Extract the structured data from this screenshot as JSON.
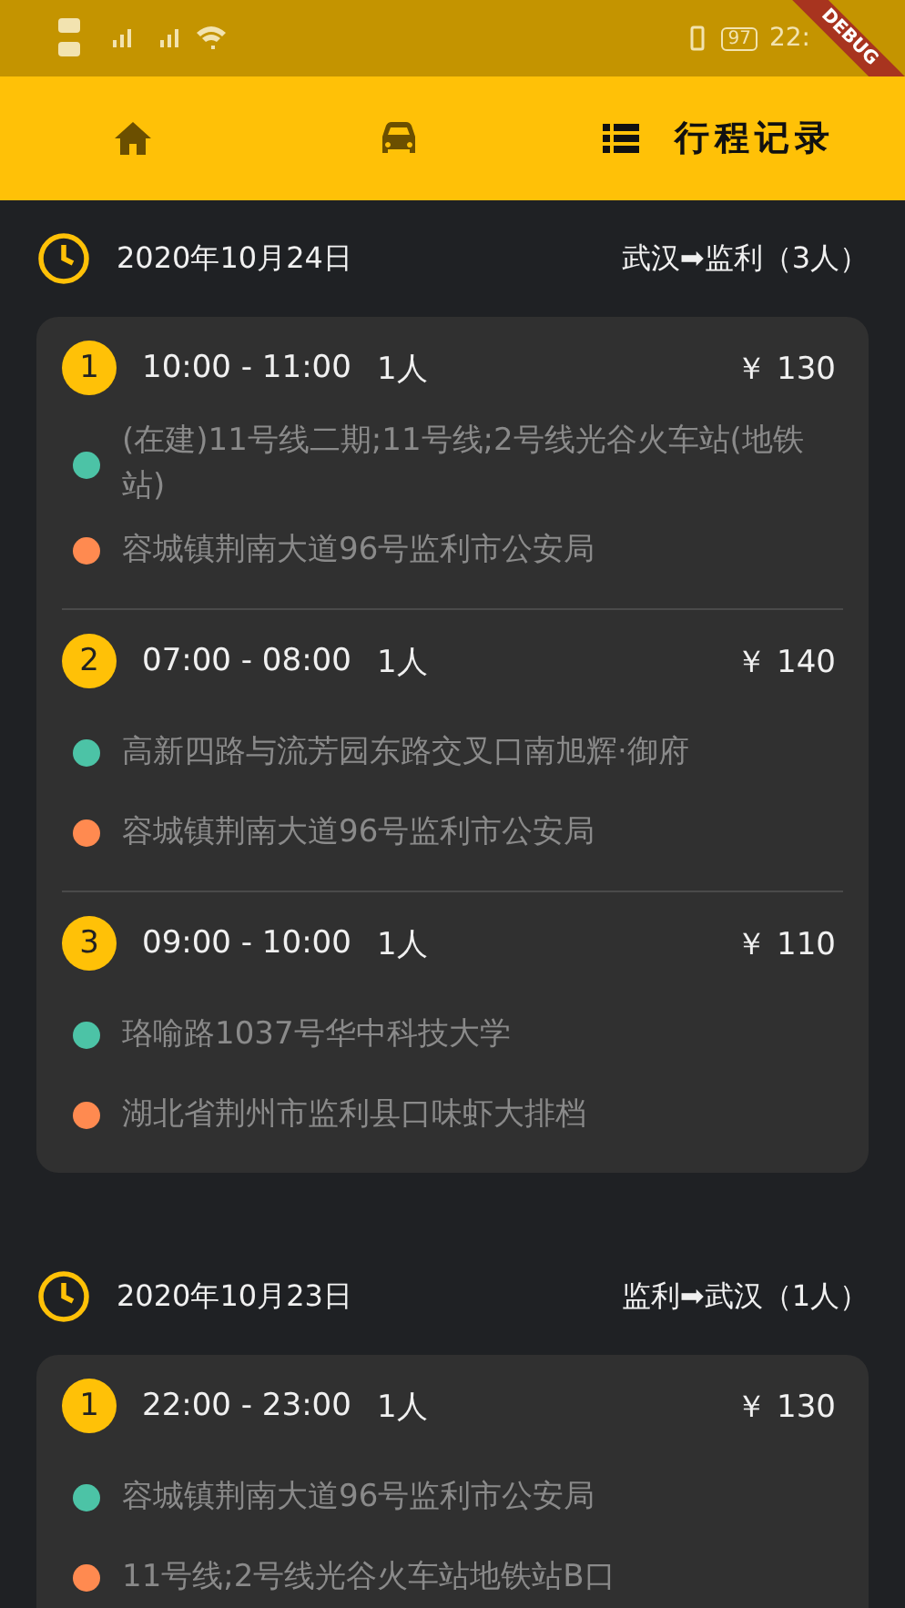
{
  "status_bar": {
    "battery": "97",
    "time": "22:"
  },
  "debug_banner": "DEBUG",
  "tabs": [
    {
      "kind": "home",
      "selected": false
    },
    {
      "kind": "car",
      "selected": false
    },
    {
      "kind": "list",
      "label": "行程记录",
      "selected": true
    }
  ],
  "groups": [
    {
      "date": "2020年10月24日",
      "route": "武汉➡监利（3人）",
      "trips": [
        {
          "index": "1",
          "time": "10:00 - 11:00",
          "people": "1人",
          "price": "￥ 130",
          "from": "(在建)11号线二期;11号线;2号线光谷火车站(地铁站)",
          "to": "容城镇荆南大道96号监利市公安局"
        },
        {
          "index": "2",
          "time": "07:00 - 08:00",
          "people": "1人",
          "price": "￥ 140",
          "from": "高新四路与流芳园东路交叉口南旭辉·御府",
          "to": "容城镇荆南大道96号监利市公安局"
        },
        {
          "index": "3",
          "time": "09:00 - 10:00",
          "people": "1人",
          "price": "￥ 110",
          "from": "珞喻路1037号华中科技大学",
          "to": "湖北省荆州市监利县口味虾大排档"
        }
      ]
    },
    {
      "date": "2020年10月23日",
      "route": "监利➡武汉（1人）",
      "trips": [
        {
          "index": "1",
          "time": "22:00 - 23:00",
          "people": "1人",
          "price": "￥ 130",
          "from": "容城镇荆南大道96号监利市公安局",
          "to": "11号线;2号线光谷火车站地铁站B口"
        }
      ]
    }
  ]
}
